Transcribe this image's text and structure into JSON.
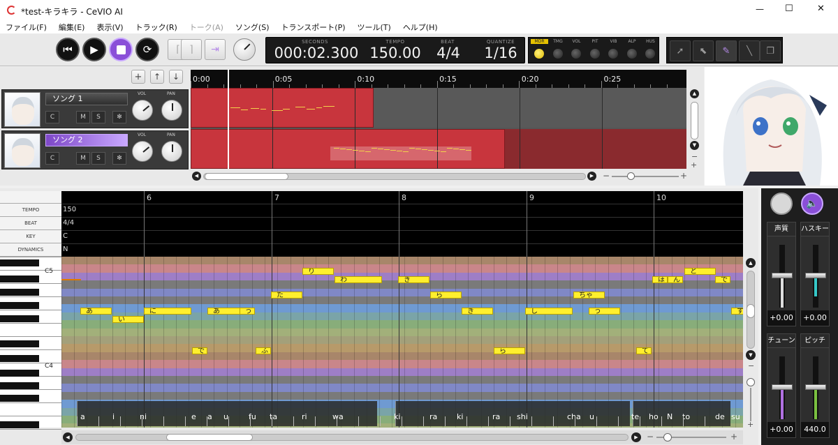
{
  "window": {
    "title": "*test-キラキラ - CeVIO AI",
    "minimize": "—",
    "maximize": "☐",
    "close": "✕"
  },
  "menu": [
    {
      "label": "ファイル(F)",
      "enabled": true
    },
    {
      "label": "編集(E)",
      "enabled": true
    },
    {
      "label": "表示(V)",
      "enabled": true
    },
    {
      "label": "トラック(R)",
      "enabled": true
    },
    {
      "label": "トーク(A)",
      "enabled": false
    },
    {
      "label": "ソング(S)",
      "enabled": true
    },
    {
      "label": "トランスポート(P)",
      "enabled": true
    },
    {
      "label": "ツール(T)",
      "enabled": true
    },
    {
      "label": "ヘルプ(H)",
      "enabled": true
    }
  ],
  "transport": {
    "seconds_label": "SECONDS",
    "seconds": "000:02.300",
    "tempo_label": "TEMPO",
    "tempo": "150.00",
    "beat_label": "BEAT",
    "beat": "4/4",
    "quantize_label": "QUANTIZE",
    "quantize": "1/16"
  },
  "toggles": [
    {
      "label": "MDR",
      "on": true
    },
    {
      "label": "TMG",
      "on": false
    },
    {
      "label": "VOL",
      "on": false
    },
    {
      "label": "PIT",
      "on": false
    },
    {
      "label": "VIB",
      "on": false
    },
    {
      "label": "ALP",
      "on": false
    },
    {
      "label": "HUS",
      "on": false
    }
  ],
  "tracks": [
    {
      "name": "ソング 1",
      "selected": false,
      "vol_label": "VOL",
      "pan_label": "PAN",
      "c": "C",
      "m": "M",
      "s": "S",
      "f": "✻"
    },
    {
      "name": "ソング 2",
      "selected": true,
      "vol_label": "VOL",
      "pan_label": "PAN",
      "c": "C",
      "m": "M",
      "s": "S",
      "f": "✻"
    }
  ],
  "timeline_labels": [
    "0:00",
    "0:05",
    "0:10",
    "0:15",
    "0:20",
    "0:25"
  ],
  "params": [
    {
      "label": "TEMPO",
      "value": "150"
    },
    {
      "label": "BEAT",
      "value": "4/4"
    },
    {
      "label": "KEY",
      "value": "C"
    },
    {
      "label": "DYNAMICS",
      "value": "N"
    }
  ],
  "bars": [
    "6",
    "7",
    "8",
    "9",
    "10"
  ],
  "keyboard": {
    "c5": "C5",
    "c4": "C4"
  },
  "notes": [
    {
      "lyric": "あ"
    },
    {
      "lyric": "い"
    },
    {
      "lyric": "に"
    },
    {
      "lyric": "あ"
    },
    {
      "lyric": "う"
    },
    {
      "lyric": "で"
    },
    {
      "lyric": "ふ"
    },
    {
      "lyric": "た"
    },
    {
      "lyric": "り"
    },
    {
      "lyric": "わ"
    },
    {
      "lyric": "き"
    },
    {
      "lyric": "ら"
    },
    {
      "lyric": "き"
    },
    {
      "lyric": "ら"
    },
    {
      "lyric": "し"
    },
    {
      "lyric": "ちゃ"
    },
    {
      "lyric": "う"
    },
    {
      "lyric": "て"
    },
    {
      "lyric": "ほ"
    },
    {
      "lyric": "ん"
    },
    {
      "lyric": "と"
    },
    {
      "lyric": "で"
    },
    {
      "lyric": "す"
    }
  ],
  "phonemes": [
    "a",
    "i",
    "ni",
    "e",
    "a",
    "u",
    "fu",
    "ta",
    "ri",
    "wa",
    "ki",
    "ra",
    "ki",
    "ra",
    "shi",
    "cha",
    "u",
    "te",
    "ho",
    "N",
    "to",
    "de",
    "su"
  ],
  "right_panel": {
    "sliders": [
      {
        "label": "声質",
        "value": "+0.00"
      },
      {
        "label": "ハスキー",
        "value": "+0.00"
      },
      {
        "label": "チューン",
        "value": "+0.00"
      },
      {
        "label": "ピッチ",
        "value": "440.0"
      }
    ]
  },
  "colors": {
    "accent": "#8a4fd8",
    "clip": "#c8353d",
    "note": "#ffef2e"
  }
}
